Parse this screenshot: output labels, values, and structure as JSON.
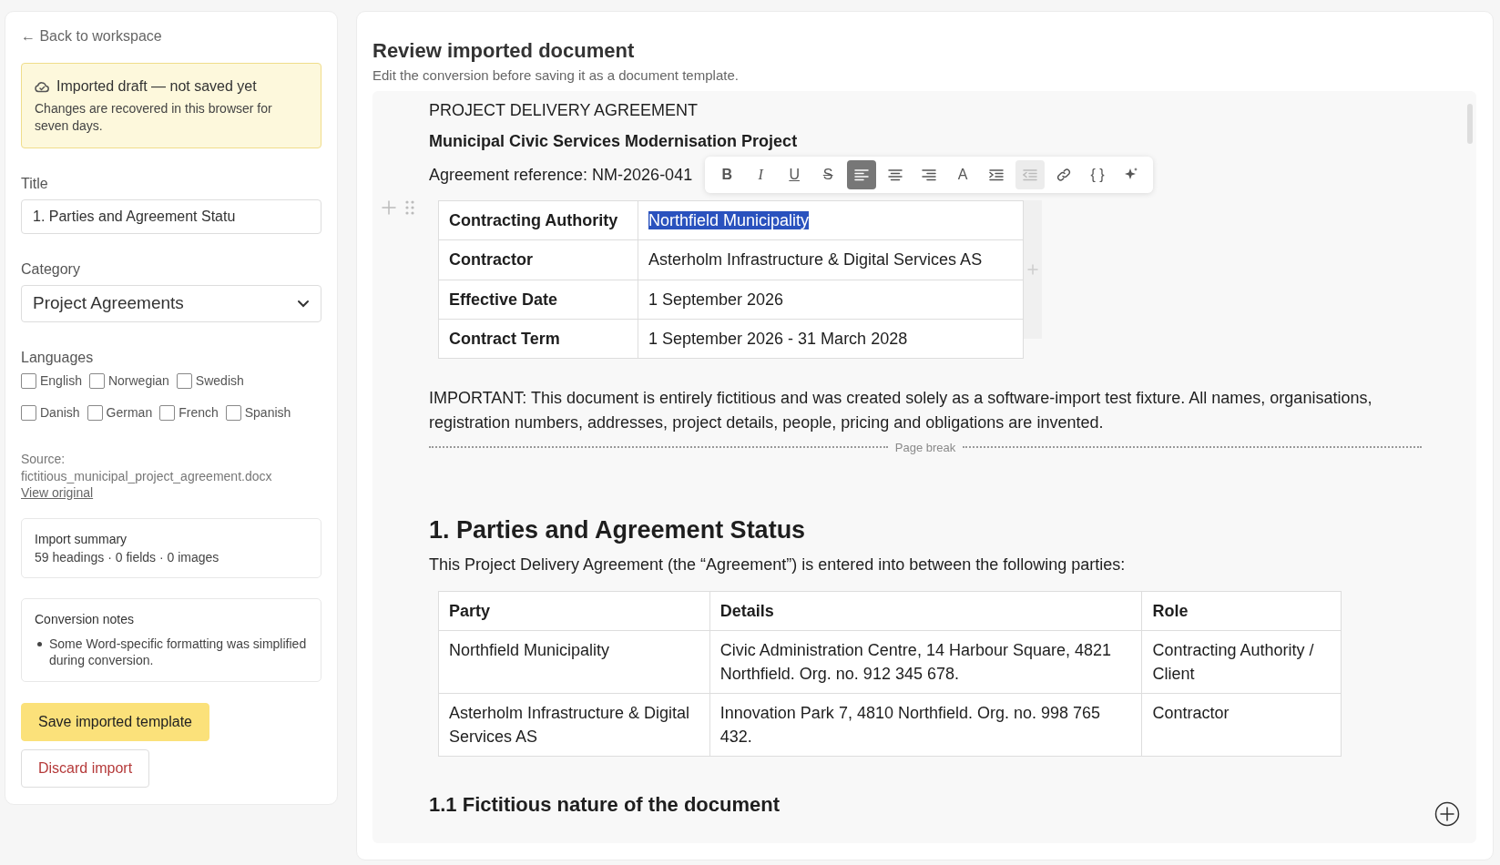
{
  "sidebar": {
    "back_link": "← Back to workspace",
    "notice": {
      "title": "Imported draft — not saved yet",
      "text": "Changes are recovered in this browser for seven days."
    },
    "title_field": {
      "label": "Title",
      "value": "1. Parties and Agreement Statu"
    },
    "category": {
      "label": "Category",
      "value": "Project Agreements"
    },
    "languages": {
      "label": "Languages",
      "options": [
        {
          "label": "English",
          "checked": false
        },
        {
          "label": "Norwegian",
          "checked": false
        },
        {
          "label": "Swedish",
          "checked": false
        },
        {
          "label": "Danish",
          "checked": false
        },
        {
          "label": "German",
          "checked": false
        },
        {
          "label": "French",
          "checked": false
        },
        {
          "label": "Spanish",
          "checked": false
        }
      ]
    },
    "source": {
      "label": "Source:",
      "file": "fictitious_municipal_project_agreement.docx",
      "link": "View original"
    },
    "summary": {
      "title": "Import summary",
      "text": "59 headings · 0 fields · 0 images"
    },
    "notes": {
      "title": "Conversion notes",
      "items": [
        "Some Word-specific formatting was simplified during conversion."
      ]
    },
    "buttons": [
      {
        "label": "Save imported template",
        "kind": "primary"
      },
      {
        "label": "Discard import",
        "kind": "danger"
      }
    ]
  },
  "main": {
    "title": "Review imported document",
    "subtitle": "Edit the conversion before saving it as a document template.",
    "document": {
      "heading": "PROJECT DELIVERY AGREEMENT",
      "subheading": "Municipal Civic Services Modernisation Project",
      "reference": "Agreement reference: NM-2026-041",
      "toolbar": [
        {
          "kind": "letter",
          "label": "B",
          "selected": false,
          "disabled": false
        },
        {
          "kind": "italic",
          "label": "I",
          "selected": false,
          "disabled": false
        },
        {
          "kind": "underline",
          "label": "U",
          "selected": false,
          "disabled": false
        },
        {
          "kind": "strike",
          "label": "S",
          "selected": false,
          "disabled": false
        },
        {
          "kind": "align-left",
          "selected": true,
          "disabled": false
        },
        {
          "kind": "align-center",
          "selected": false,
          "disabled": false
        },
        {
          "kind": "align-right",
          "selected": false,
          "disabled": false
        },
        {
          "kind": "color",
          "label": "A",
          "selected": false,
          "disabled": false
        },
        {
          "kind": "indent",
          "selected": false,
          "disabled": false
        },
        {
          "kind": "outdent",
          "selected": false,
          "disabled": true
        },
        {
          "kind": "link",
          "selected": false,
          "disabled": false
        },
        {
          "kind": "code",
          "label": "{ }",
          "selected": false,
          "disabled": false
        },
        {
          "kind": "sparkle",
          "selected": false,
          "disabled": false
        }
      ],
      "info_table": [
        {
          "label": "Contracting Authority",
          "value": "Northfield Municipality",
          "selected": true
        },
        {
          "label": "Contractor",
          "value": "Asterholm Infrastructure & Digital Services AS",
          "selected": false
        },
        {
          "label": "Effective Date",
          "value": "1 September 2026",
          "selected": false
        },
        {
          "label": "Contract Term",
          "value": "1 September 2026 - 31 March 2028",
          "selected": false
        }
      ],
      "notice": "IMPORTANT: This document is entirely fictitious and was created solely as a software-import test fixture. All names, organisations, registration numbers, addresses, project details, people, pricing and obligations are invented.",
      "page_break": "Page break",
      "section_title": "1. Parties and Agreement Status",
      "intro": "This Project Delivery Agreement (the “Agreement”) is entered into between the following parties:",
      "parties_table": {
        "columns": [
          "Party",
          "Details",
          "Role"
        ],
        "rows": [
          [
            "Northfield Municipality",
            "Civic Administration Centre, 14 Harbour Square, 4821 Northfield. Org. no. 912 345 678.",
            "Contracting Authority / Client"
          ],
          [
            "Asterholm Infrastructure & Digital Services AS",
            "Innovation Park 7, 4810 Northfield. Org. no. 998 765 432.",
            "Contractor"
          ]
        ]
      },
      "subsection_title": "1.1 Fictitious nature of the document"
    }
  }
}
